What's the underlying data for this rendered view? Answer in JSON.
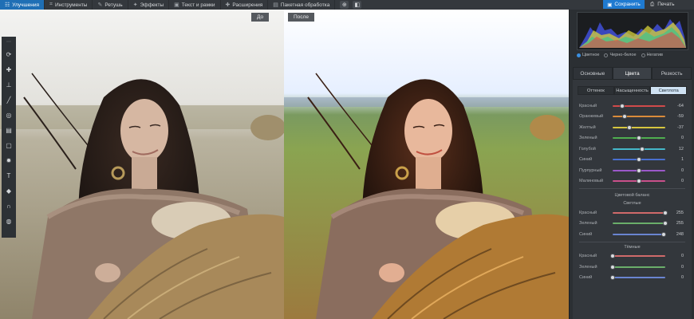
{
  "toolbar": {
    "tabs": [
      {
        "label": "Улучшения",
        "icon": "sliders-icon",
        "active": true
      },
      {
        "label": "Инструменты",
        "icon": "crop-icon",
        "active": false
      },
      {
        "label": "Ретушь",
        "icon": "brush-icon",
        "active": false
      },
      {
        "label": "Эффекты",
        "icon": "magic-wand-icon",
        "active": false
      },
      {
        "label": "Текст и рамки",
        "icon": "text-frame-icon",
        "active": false
      },
      {
        "label": "Расширения",
        "icon": "plus-icon",
        "active": false
      },
      {
        "label": "Пакетная обработка",
        "icon": "batch-icon",
        "active": false
      }
    ],
    "save_label": "Сохранить",
    "print_label": "Печать"
  },
  "canvas": {
    "before_label": "До",
    "after_label": "После"
  },
  "left_tools": [
    "rotate-icon",
    "heal-icon",
    "stamp-icon",
    "brush-icon",
    "radial-icon",
    "gradient-icon",
    "vignette-icon",
    "light-icon",
    "text-icon",
    "fill-icon",
    "magnet-icon",
    "globe-icon"
  ],
  "panel": {
    "view_modes": [
      {
        "label": "Цветное",
        "selected": true
      },
      {
        "label": "Черно-белое",
        "selected": false
      },
      {
        "label": "Негатив",
        "selected": false
      }
    ],
    "main_tabs": [
      {
        "label": "Основные",
        "active": false
      },
      {
        "label": "Цвета",
        "active": true
      },
      {
        "label": "Резкость",
        "active": false
      }
    ],
    "sub_tabs": [
      {
        "label": "Оттенок",
        "active": false
      },
      {
        "label": "Насыщенность",
        "active": false
      },
      {
        "label": "Светлота",
        "active": true
      }
    ],
    "sliders": [
      {
        "label": "Красный",
        "value": "-64",
        "pos": 0.18,
        "color": "#d04a4a"
      },
      {
        "label": "Оранжевый",
        "value": "-59",
        "pos": 0.22,
        "color": "#d98b3a"
      },
      {
        "label": "Желтый",
        "value": "-37",
        "pos": 0.32,
        "color": "#d6c63f"
      },
      {
        "label": "Зеленый",
        "value": "0",
        "pos": 0.5,
        "color": "#4fae4f"
      },
      {
        "label": "Голубой",
        "value": "12",
        "pos": 0.56,
        "color": "#45b8c9"
      },
      {
        "label": "Синий",
        "value": "1",
        "pos": 0.5,
        "color": "#4a6fd0"
      },
      {
        "label": "Пурпурный",
        "value": "0",
        "pos": 0.5,
        "color": "#9b58c9"
      },
      {
        "label": "Малиновый",
        "value": "0",
        "pos": 0.5,
        "color": "#c9508a"
      }
    ],
    "balance_title": "Цветовой баланс",
    "light_title": "Светлые",
    "light_sliders": [
      {
        "label": "Красный",
        "value": "255",
        "pos": 1.0,
        "color": "#d06a6a"
      },
      {
        "label": "Зеленый",
        "value": "255",
        "pos": 1.0,
        "color": "#6aae6a"
      },
      {
        "label": "Синий",
        "value": "248",
        "pos": 0.97,
        "color": "#6a84d0"
      }
    ],
    "dark_title": "Тёмные",
    "dark_sliders": [
      {
        "label": "Красный",
        "value": "0",
        "pos": 0.0,
        "color": "#d06a6a"
      },
      {
        "label": "Зеленый",
        "value": "0",
        "pos": 0.0,
        "color": "#6aae6a"
      },
      {
        "label": "Синий",
        "value": "0",
        "pos": 0.0,
        "color": "#6a84d0"
      }
    ]
  }
}
